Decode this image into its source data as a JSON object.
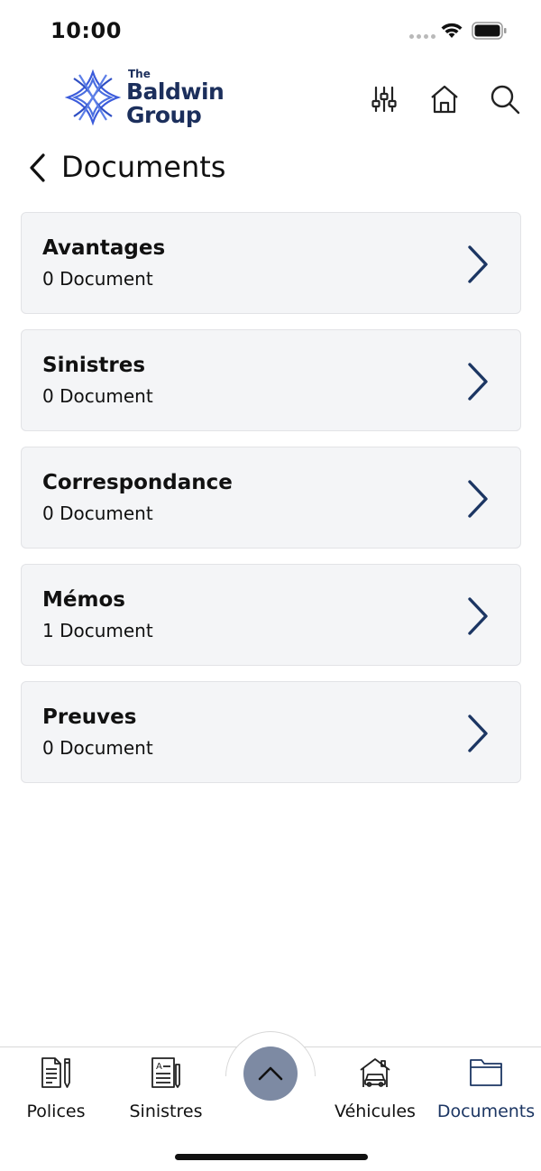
{
  "status_bar": {
    "time": "10:00"
  },
  "header": {
    "logo": {
      "line1": "The",
      "line2": "Baldwin",
      "line3": "Group"
    },
    "icons": [
      "filter-sliders-icon",
      "home-icon",
      "search-icon"
    ]
  },
  "page": {
    "title": "Documents"
  },
  "categories": [
    {
      "title": "Avantages",
      "count": "0 Document"
    },
    {
      "title": "Sinistres",
      "count": "0 Document"
    },
    {
      "title": "Correspondance",
      "count": "0 Document"
    },
    {
      "title": "Mémos",
      "count": "1 Document"
    },
    {
      "title": "Preuves",
      "count": "0 Document"
    }
  ],
  "bottom_nav": {
    "items": [
      {
        "label": "Polices",
        "icon": "policy-document-icon"
      },
      {
        "label": "Sinistres",
        "icon": "claim-form-icon"
      },
      {
        "label": "Véhicules",
        "icon": "car-garage-icon"
      },
      {
        "label": "Documents",
        "icon": "folder-icon",
        "active": true
      }
    ],
    "fab_icon": "chevron-up-icon"
  },
  "colors": {
    "brand_navy": "#1c2f5c",
    "brand_blue": "#3b5bdb",
    "card_bg": "#f4f5f7",
    "chevron": "#1c3663",
    "fab_bg": "#7d8aa3"
  }
}
